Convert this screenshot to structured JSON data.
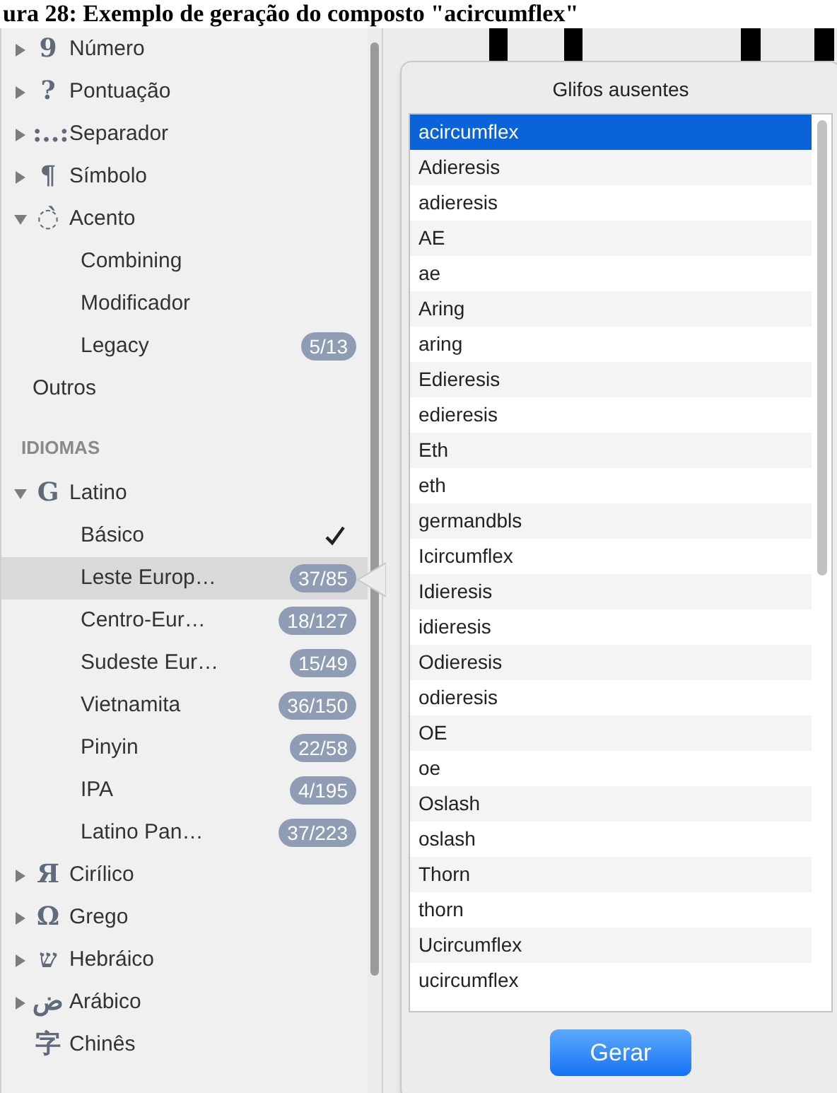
{
  "caption": "ura 28: Exemplo de geração do composto \"acircumflex\"",
  "sidebar": {
    "categories": [
      {
        "label": "Número",
        "icon": "9",
        "expanded": false
      },
      {
        "label": "Pontuação",
        "icon": "?",
        "expanded": false
      },
      {
        "label": "Separador",
        "icon": ":..:",
        "expanded": false
      },
      {
        "label": "Símbolo",
        "icon": "¶",
        "expanded": false
      },
      {
        "label": "Acento",
        "icon": "◌̀",
        "expanded": true,
        "children": [
          {
            "label": "Combining"
          },
          {
            "label": "Modificador"
          },
          {
            "label": "Legacy",
            "badge": "5/13"
          }
        ]
      },
      {
        "label": "Outros"
      }
    ],
    "languages_header": "IDIOMAS",
    "languages": [
      {
        "label": "Latino",
        "icon": "G",
        "expanded": true,
        "children": [
          {
            "label": "Básico",
            "checked": true,
            "selected": false
          },
          {
            "label": "Leste Europ…",
            "badge": "37/85",
            "checked": false,
            "selected": true
          },
          {
            "label": "Centro-Eur…",
            "badge": "18/127",
            "checked": false,
            "selected": false
          },
          {
            "label": "Sudeste Eur…",
            "badge": "15/49",
            "checked": false,
            "selected": false
          },
          {
            "label": "Vietnamita",
            "badge": "36/150",
            "checked": false,
            "selected": false
          },
          {
            "label": "Pinyin",
            "badge": "22/58",
            "checked": false,
            "selected": false
          },
          {
            "label": "IPA",
            "badge": "4/195",
            "checked": false,
            "selected": false
          },
          {
            "label": "Latino Pan…",
            "badge": "37/223",
            "checked": false,
            "selected": false
          }
        ]
      },
      {
        "label": "Cirílico",
        "icon": "Я",
        "expanded": false
      },
      {
        "label": "Grego",
        "icon": "Ω",
        "expanded": false
      },
      {
        "label": "Hebráico",
        "icon": "ש",
        "expanded": false
      },
      {
        "label": "Arábico",
        "icon": "ض",
        "expanded": false
      },
      {
        "label": "Chinês",
        "icon": "字"
      }
    ]
  },
  "popover": {
    "title": "Glifos ausentes",
    "glyphs": [
      {
        "name": "acircumflex",
        "selected": true
      },
      {
        "name": "Adieresis",
        "selected": false
      },
      {
        "name": "adieresis",
        "selected": false
      },
      {
        "name": "AE",
        "selected": false
      },
      {
        "name": "ae",
        "selected": false
      },
      {
        "name": "Aring",
        "selected": false
      },
      {
        "name": "aring",
        "selected": false
      },
      {
        "name": "Edieresis",
        "selected": false
      },
      {
        "name": "edieresis",
        "selected": false
      },
      {
        "name": "Eth",
        "selected": false
      },
      {
        "name": "eth",
        "selected": false
      },
      {
        "name": "germandbls",
        "selected": false
      },
      {
        "name": "Icircumflex",
        "selected": false
      },
      {
        "name": "Idieresis",
        "selected": false
      },
      {
        "name": "idieresis",
        "selected": false
      },
      {
        "name": "Odieresis",
        "selected": false
      },
      {
        "name": "odieresis",
        "selected": false
      },
      {
        "name": "OE",
        "selected": false
      },
      {
        "name": "oe",
        "selected": false
      },
      {
        "name": "Oslash",
        "selected": false
      },
      {
        "name": "oslash",
        "selected": false
      },
      {
        "name": "Thorn",
        "selected": false
      },
      {
        "name": "thorn",
        "selected": false
      },
      {
        "name": "Ucircumflex",
        "selected": false
      },
      {
        "name": "ucircumflex",
        "selected": false
      }
    ],
    "button": "Gerar"
  }
}
